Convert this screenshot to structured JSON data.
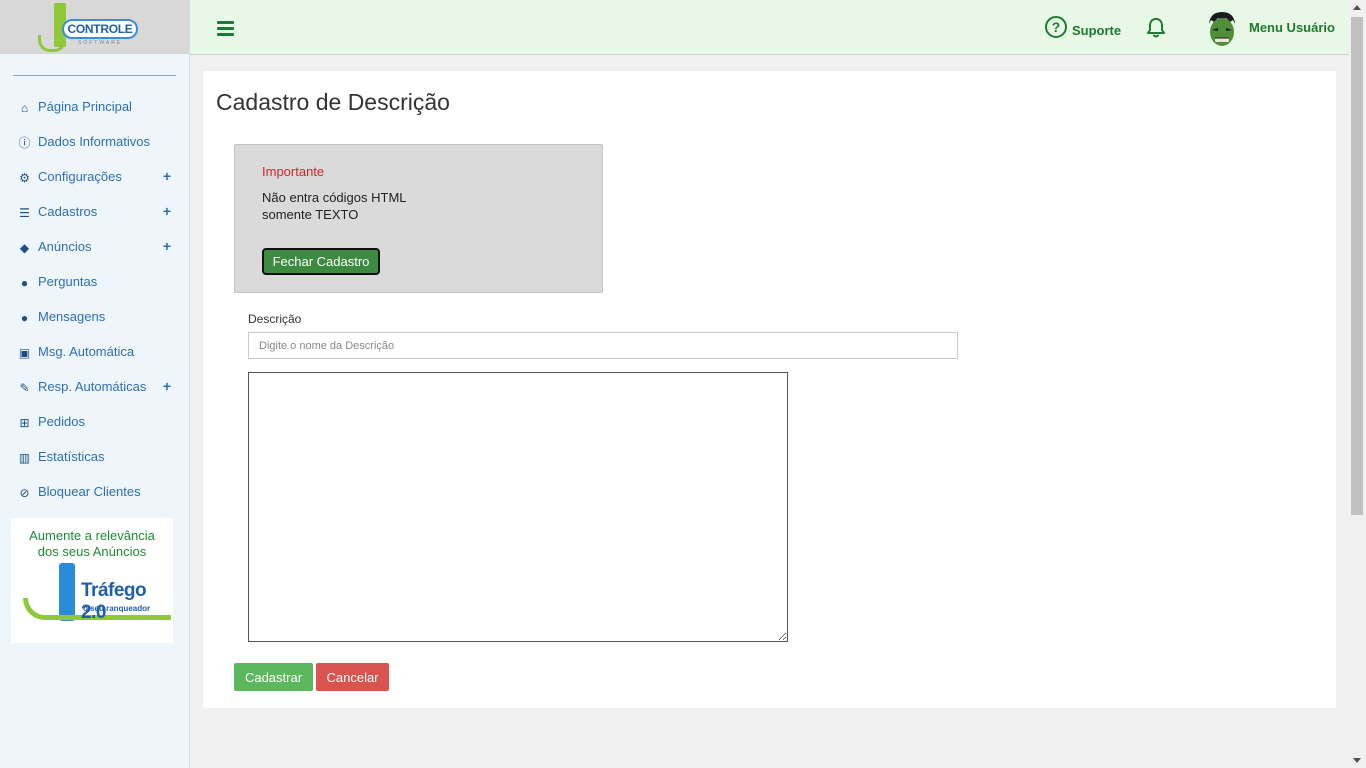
{
  "logo": {
    "name": "CONTROLE",
    "tagline": "SOFTWARE"
  },
  "sidebar": {
    "items": [
      {
        "label": "Página Principal",
        "icon": "home-icon",
        "glyph": "⌂",
        "expandable": false
      },
      {
        "label": "Dados Informativos",
        "icon": "info-icon",
        "glyph": "ⓘ",
        "expandable": false
      },
      {
        "label": "Configurações",
        "icon": "gear-icon",
        "glyph": "⚙",
        "expandable": true,
        "expand_glyph": "+"
      },
      {
        "label": "Cadastros",
        "icon": "list-icon",
        "glyph": "☰",
        "expandable": true,
        "expand_glyph": "+"
      },
      {
        "label": "Anúncios",
        "icon": "tags-icon",
        "glyph": "◆",
        "expandable": true,
        "expand_glyph": "+"
      },
      {
        "label": "Perguntas",
        "icon": "comment-icon",
        "glyph": "●",
        "expandable": false
      },
      {
        "label": "Mensagens",
        "icon": "comments-icon",
        "glyph": "●",
        "expandable": false
      },
      {
        "label": "Msg. Automática",
        "icon": "robot-icon",
        "glyph": "▣",
        "expandable": false
      },
      {
        "label": "Resp. Automáticas",
        "icon": "magic-wand-icon",
        "glyph": "✎",
        "expandable": true,
        "expand_glyph": "+"
      },
      {
        "label": "Pedidos",
        "icon": "cart-icon",
        "glyph": "⊞",
        "expandable": false
      },
      {
        "label": "Estatísticas",
        "icon": "bar-chart-icon",
        "glyph": "▥",
        "expandable": false
      },
      {
        "label": "Bloquear Clientes",
        "icon": "ban-icon",
        "glyph": "⊘",
        "expandable": false
      }
    ],
    "banner": {
      "headline_1": "Aumente a relevância",
      "headline_2": "dos seus Anúncios",
      "brand": "Tráfego 2.0",
      "brand_tagline": "o seu ranqueador"
    }
  },
  "topbar": {
    "support_label": "Suporte",
    "support_glyph": "?",
    "user_menu_label": "Menu Usuário"
  },
  "main": {
    "page_title": "Cadastro de Descrição",
    "notice": {
      "heading": "Importante",
      "line_1": "Não entra códigos HTML",
      "line_2": "somente TEXTO",
      "close_button": "Fechar Cadastro"
    },
    "form": {
      "description_label": "Descrição",
      "description_placeholder": "Digite o nome da Descrição",
      "description_value": "",
      "body_text": ""
    },
    "actions": {
      "submit": "Cadastrar",
      "cancel": "Cancelar"
    }
  },
  "colors": {
    "accent_green": "#1e7a2f",
    "link_blue": "#2f6fb1",
    "success": "#5cb85c",
    "danger": "#d9534f",
    "notice_heading": "#d0252a"
  }
}
